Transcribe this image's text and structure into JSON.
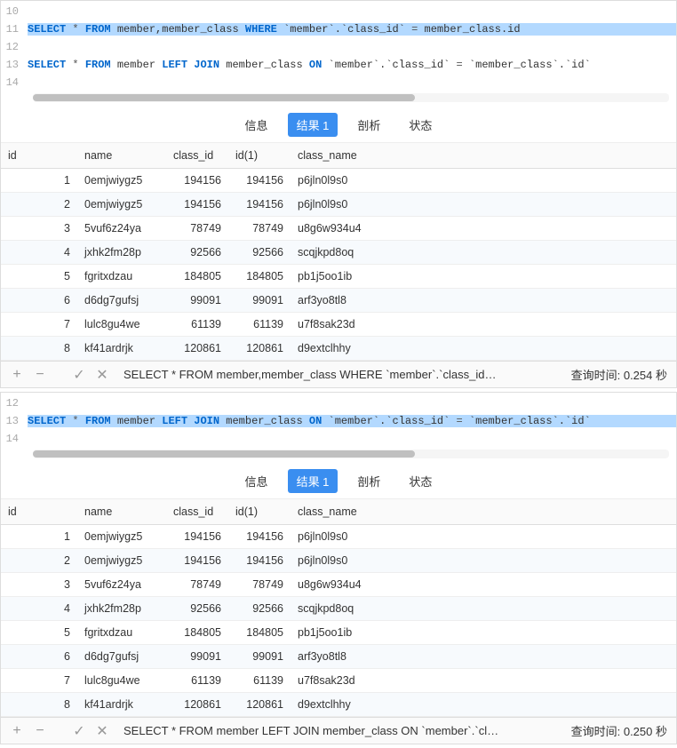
{
  "panels": [
    {
      "editor": {
        "lines": [
          {
            "num": "10",
            "tokens": []
          },
          {
            "num": "11",
            "highlighted": true,
            "tokens": [
              {
                "t": "SELECT",
                "c": "kw"
              },
              {
                "t": " ",
                "c": "sp"
              },
              {
                "t": "*",
                "c": "op"
              },
              {
                "t": " ",
                "c": "sp"
              },
              {
                "t": "FROM",
                "c": "kw"
              },
              {
                "t": " ",
                "c": "sp"
              },
              {
                "t": "member,member_class",
                "c": "tk"
              },
              {
                "t": " ",
                "c": "sp"
              },
              {
                "t": "WHERE",
                "c": "kw"
              },
              {
                "t": " ",
                "c": "sp"
              },
              {
                "t": "`member`.`class_id`",
                "c": "tk"
              },
              {
                "t": " ",
                "c": "sp"
              },
              {
                "t": "=",
                "c": "op"
              },
              {
                "t": " ",
                "c": "sp"
              },
              {
                "t": "member_class.id",
                "c": "tk"
              }
            ]
          },
          {
            "num": "12",
            "tokens": []
          },
          {
            "num": "13",
            "tokens": [
              {
                "t": "SELECT",
                "c": "kw"
              },
              {
                "t": " ",
                "c": "sp"
              },
              {
                "t": "*",
                "c": "op"
              },
              {
                "t": " ",
                "c": "sp"
              },
              {
                "t": "FROM",
                "c": "kw"
              },
              {
                "t": " ",
                "c": "sp"
              },
              {
                "t": "member",
                "c": "tk"
              },
              {
                "t": " ",
                "c": "sp"
              },
              {
                "t": "LEFT JOIN",
                "c": "kw"
              },
              {
                "t": " ",
                "c": "sp"
              },
              {
                "t": "member_class",
                "c": "tk"
              },
              {
                "t": " ",
                "c": "sp"
              },
              {
                "t": "ON",
                "c": "kw"
              },
              {
                "t": " ",
                "c": "sp"
              },
              {
                "t": "`member`.`class_id`",
                "c": "tk"
              },
              {
                "t": " ",
                "c": "sp"
              },
              {
                "t": "=",
                "c": "op"
              },
              {
                "t": " ",
                "c": "sp"
              },
              {
                "t": "`member_class`.`id`",
                "c": "tk"
              }
            ]
          },
          {
            "num": "14",
            "tokens": []
          }
        ]
      },
      "tabs": {
        "info": "信息",
        "result": "结果 1",
        "profile": "剖析",
        "status": "状态",
        "active": "result"
      },
      "table": {
        "headers": {
          "id": "id",
          "name": "name",
          "class_id": "class_id",
          "id1": "id(1)",
          "class_name": "class_name"
        },
        "rows": [
          {
            "n": "1",
            "name": "0emjwiygz5",
            "class_id": "194156",
            "id1": "194156",
            "class_name": "p6jln0l9s0"
          },
          {
            "n": "2",
            "name": "0emjwiygz5",
            "class_id": "194156",
            "id1": "194156",
            "class_name": "p6jln0l9s0"
          },
          {
            "n": "3",
            "name": "5vuf6z24ya",
            "class_id": "78749",
            "id1": "78749",
            "class_name": "u8g6w934u4"
          },
          {
            "n": "4",
            "name": "jxhk2fm28p",
            "class_id": "92566",
            "id1": "92566",
            "class_name": "scqjkpd8oq"
          },
          {
            "n": "5",
            "name": "fgritxdzau",
            "class_id": "184805",
            "id1": "184805",
            "class_name": "pb1j5oo1ib"
          },
          {
            "n": "6",
            "name": "d6dg7gufsj",
            "class_id": "99091",
            "id1": "99091",
            "class_name": "arf3yo8tl8"
          },
          {
            "n": "7",
            "name": "lulc8gu4we",
            "class_id": "61139",
            "id1": "61139",
            "class_name": "u7f8sak23d"
          },
          {
            "n": "8",
            "name": "kf41ardrjk",
            "class_id": "120861",
            "id1": "120861",
            "class_name": "d9extclhhy"
          }
        ]
      },
      "statusbar": {
        "query": "SELECT * FROM member,member_class WHERE `member`.`class_id…",
        "time_label": "查询时间:",
        "time_value": "0.254 秒"
      }
    },
    {
      "editor": {
        "lines": [
          {
            "num": "12",
            "tokens": []
          },
          {
            "num": "13",
            "highlighted": true,
            "tokens": [
              {
                "t": "SELECT",
                "c": "kw"
              },
              {
                "t": " ",
                "c": "sp"
              },
              {
                "t": "*",
                "c": "op"
              },
              {
                "t": " ",
                "c": "sp"
              },
              {
                "t": "FROM",
                "c": "kw"
              },
              {
                "t": " ",
                "c": "sp"
              },
              {
                "t": "member",
                "c": "tk"
              },
              {
                "t": " ",
                "c": "sp"
              },
              {
                "t": "LEFT JOIN",
                "c": "kw"
              },
              {
                "t": " ",
                "c": "sp"
              },
              {
                "t": "member_class",
                "c": "tk"
              },
              {
                "t": " ",
                "c": "sp"
              },
              {
                "t": "ON",
                "c": "kw"
              },
              {
                "t": " ",
                "c": "sp"
              },
              {
                "t": "`member`.`class_id`",
                "c": "tk"
              },
              {
                "t": " ",
                "c": "sp"
              },
              {
                "t": "=",
                "c": "op"
              },
              {
                "t": " ",
                "c": "sp"
              },
              {
                "t": "`member_class`.`id`",
                "c": "tk"
              }
            ]
          },
          {
            "num": "14",
            "tokens": []
          }
        ]
      },
      "tabs": {
        "info": "信息",
        "result": "结果 1",
        "profile": "剖析",
        "status": "状态",
        "active": "result"
      },
      "table": {
        "headers": {
          "id": "id",
          "name": "name",
          "class_id": "class_id",
          "id1": "id(1)",
          "class_name": "class_name"
        },
        "rows": [
          {
            "n": "1",
            "name": "0emjwiygz5",
            "class_id": "194156",
            "id1": "194156",
            "class_name": "p6jln0l9s0"
          },
          {
            "n": "2",
            "name": "0emjwiygz5",
            "class_id": "194156",
            "id1": "194156",
            "class_name": "p6jln0l9s0"
          },
          {
            "n": "3",
            "name": "5vuf6z24ya",
            "class_id": "78749",
            "id1": "78749",
            "class_name": "u8g6w934u4"
          },
          {
            "n": "4",
            "name": "jxhk2fm28p",
            "class_id": "92566",
            "id1": "92566",
            "class_name": "scqjkpd8oq"
          },
          {
            "n": "5",
            "name": "fgritxdzau",
            "class_id": "184805",
            "id1": "184805",
            "class_name": "pb1j5oo1ib"
          },
          {
            "n": "6",
            "name": "d6dg7gufsj",
            "class_id": "99091",
            "id1": "99091",
            "class_name": "arf3yo8tl8"
          },
          {
            "n": "7",
            "name": "lulc8gu4we",
            "class_id": "61139",
            "id1": "61139",
            "class_name": "u7f8sak23d"
          },
          {
            "n": "8",
            "name": "kf41ardrjk",
            "class_id": "120861",
            "id1": "120861",
            "class_name": "d9extclhhy"
          }
        ]
      },
      "statusbar": {
        "query": "SELECT * FROM member LEFT JOIN member_class ON `member`.`cl…",
        "time_label": "查询时间:",
        "time_value": "0.250 秒"
      }
    }
  ],
  "icons": {
    "plus": "+",
    "minus": "−",
    "check": "✓",
    "x": "✕"
  }
}
